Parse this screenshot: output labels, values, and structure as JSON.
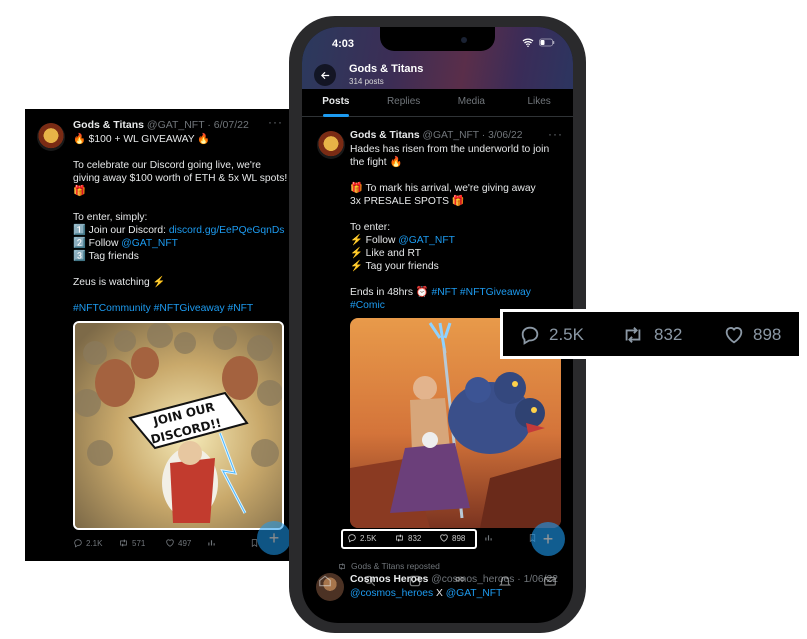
{
  "left_tweet": {
    "name": "Gods & Titans",
    "handle": "@GAT_NFT",
    "date": "· 6/07/22",
    "lines": [
      "🔥 $100 + WL GIVEAWAY 🔥",
      "",
      "To celebrate our Discord going live, we're",
      "giving away $100 worth of ETH & 5x WL spots!",
      "🎁",
      "",
      "To enter, simply:"
    ],
    "step1_prefix": "1️⃣ Join our Discord: ",
    "step1_link": "discord.gg/EePQeGqnDs",
    "step2_prefix": "2️⃣ Follow ",
    "step2_link": "@GAT_NFT",
    "step3": "3️⃣ Tag friends",
    "zeus": "Zeus is watching ⚡",
    "hashtags": "#NFTCommunity #NFTGiveaway #NFT",
    "image_text": "JOIN OUR DISCORD!!",
    "replies": "2.1K",
    "retweets": "571",
    "likes": "497"
  },
  "phone": {
    "time": "4:03",
    "profile_name": "Gods & Titans",
    "post_count": "314 posts",
    "tabs": [
      "Posts",
      "Replies",
      "Media",
      "Likes"
    ],
    "tweet": {
      "name": "Gods & Titans",
      "handle": "@GAT_NFT",
      "date": "· 3/06/22",
      "lines": [
        "Hades has risen from the underworld to join",
        "the fight 🔥",
        "",
        "🎁  To mark his arrival, we're giving away",
        "3x PRESALE SPOTS 🎁",
        "",
        "To enter:"
      ],
      "follow_prefix": "⚡ Follow ",
      "follow_link": "@GAT_NFT",
      "like_rt": "⚡ Like and RT",
      "tag": "⚡ Tag your friends",
      "ends_prefix": "Ends in 48hrs ⏰ ",
      "ends_tags": "#NFT #NFTGiveaway",
      "comic_tag": "#Comic",
      "replies": "2.5K",
      "retweets": "832",
      "likes": "898"
    },
    "repost_label": "Gods & Titans reposted",
    "next_tweet": {
      "name": "Cosmos Heroes",
      "handle": "@cosmos_heroes",
      "date": "· 1/06/22",
      "body_link1": "@cosmos_heroes",
      "body_mid": " X ",
      "body_link2": "@GAT_NFT"
    }
  },
  "zoom": {
    "replies": "2.5K",
    "retweets": "832",
    "likes": "898"
  },
  "colors": {
    "link": "#1d9bf0",
    "muted": "#71767b",
    "background": "#000000"
  }
}
